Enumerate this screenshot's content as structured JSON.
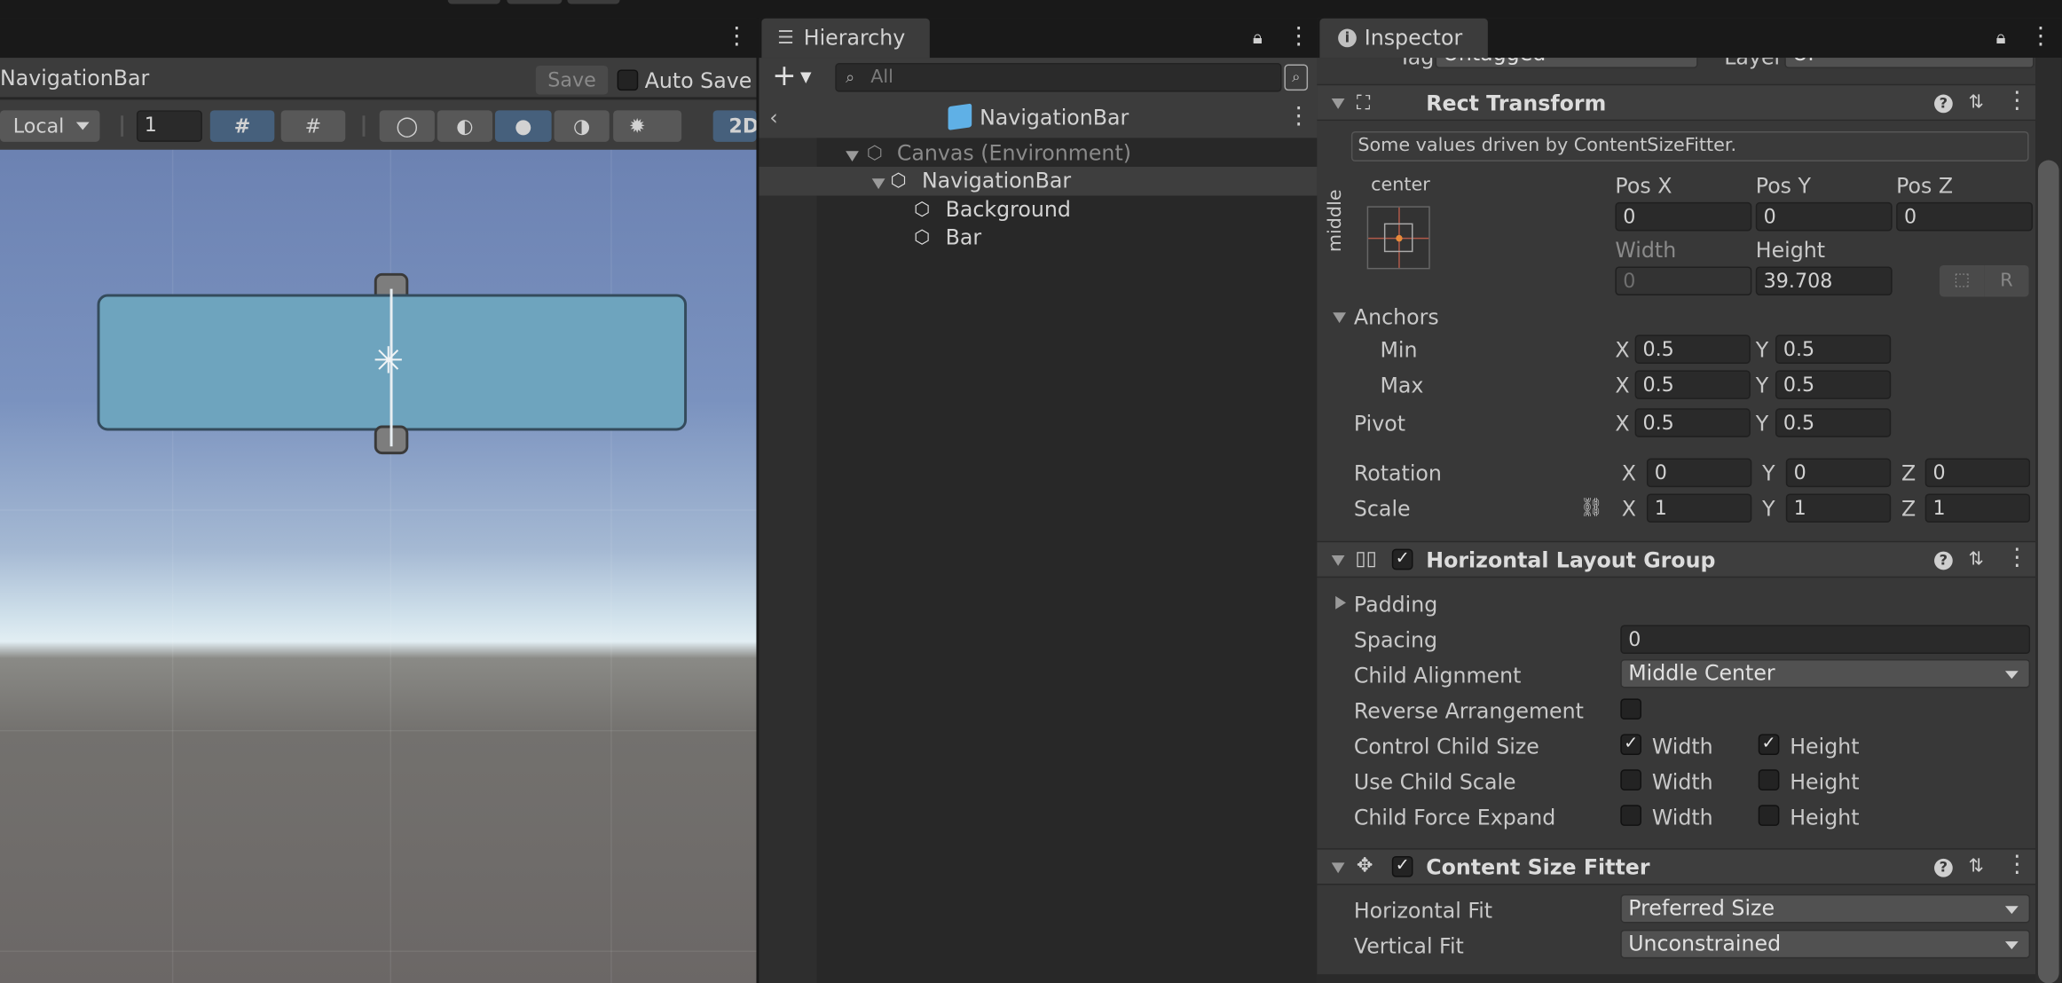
{
  "scene": {
    "title": "NavigationBar",
    "save_label": "Save",
    "auto_save_label": "Auto Save",
    "pivot_mode": "Local",
    "grid_size": "1",
    "mode_2d": "2D",
    "menu_icon": "more-vert-icon"
  },
  "hierarchy": {
    "tab_label": "Hierarchy",
    "search_placeholder": "All",
    "scene_title": "NavigationBar",
    "items": [
      {
        "label": "Canvas (Environment)"
      },
      {
        "label": "NavigationBar"
      },
      {
        "label": "Background"
      },
      {
        "label": "Bar"
      }
    ]
  },
  "inspector": {
    "tab_label": "Inspector",
    "top_row": {
      "tag_label": "Tag",
      "tag_value": "Untagged",
      "layer_label": "Layer",
      "layer_value": "UI"
    },
    "rect_transform": {
      "title": "Rect Transform",
      "driven_note": "Some values driven by ContentSizeFitter.",
      "anchor_h": "center",
      "anchor_v": "middle",
      "pos_x_label": "Pos X",
      "pos_y_label": "Pos Y",
      "pos_z_label": "Pos Z",
      "pos_x": "0",
      "pos_y": "0",
      "pos_z": "0",
      "width_label": "Width",
      "height_label": "Height",
      "width": "0",
      "height": "39.708",
      "raw_button": "R",
      "anchors_label": "Anchors",
      "min_label": "Min",
      "max_label": "Max",
      "min_x": "0.5",
      "min_y": "0.5",
      "max_x": "0.5",
      "max_y": "0.5",
      "pivot_label": "Pivot",
      "pivot_x": "0.5",
      "pivot_y": "0.5",
      "rotation_label": "Rotation",
      "rot_x": "0",
      "rot_y": "0",
      "rot_z": "0",
      "scale_label": "Scale",
      "scale_x": "1",
      "scale_y": "1",
      "scale_z": "1",
      "x": "X",
      "y": "Y",
      "z": "Z"
    },
    "horizontal_layout": {
      "title": "Horizontal Layout Group",
      "padding_label": "Padding",
      "spacing_label": "Spacing",
      "spacing": "0",
      "child_alignment_label": "Child Alignment",
      "child_alignment": "Middle Center",
      "reverse_label": "Reverse Arrangement",
      "control_size_label": "Control Child Size",
      "use_scale_label": "Use Child Scale",
      "force_expand_label": "Child Force Expand",
      "width_label": "Width",
      "height_label": "Height"
    },
    "content_size_fitter": {
      "title": "Content Size Fitter",
      "horizontal_fit_label": "Horizontal Fit",
      "horizontal_fit": "Preferred Size",
      "vertical_fit_label": "Vertical Fit",
      "vertical_fit": "Unconstrained"
    }
  },
  "colors": {
    "scene_accent": "#46607c",
    "selection": "#6ea4be",
    "cube_icon": "#5fb0e6"
  }
}
